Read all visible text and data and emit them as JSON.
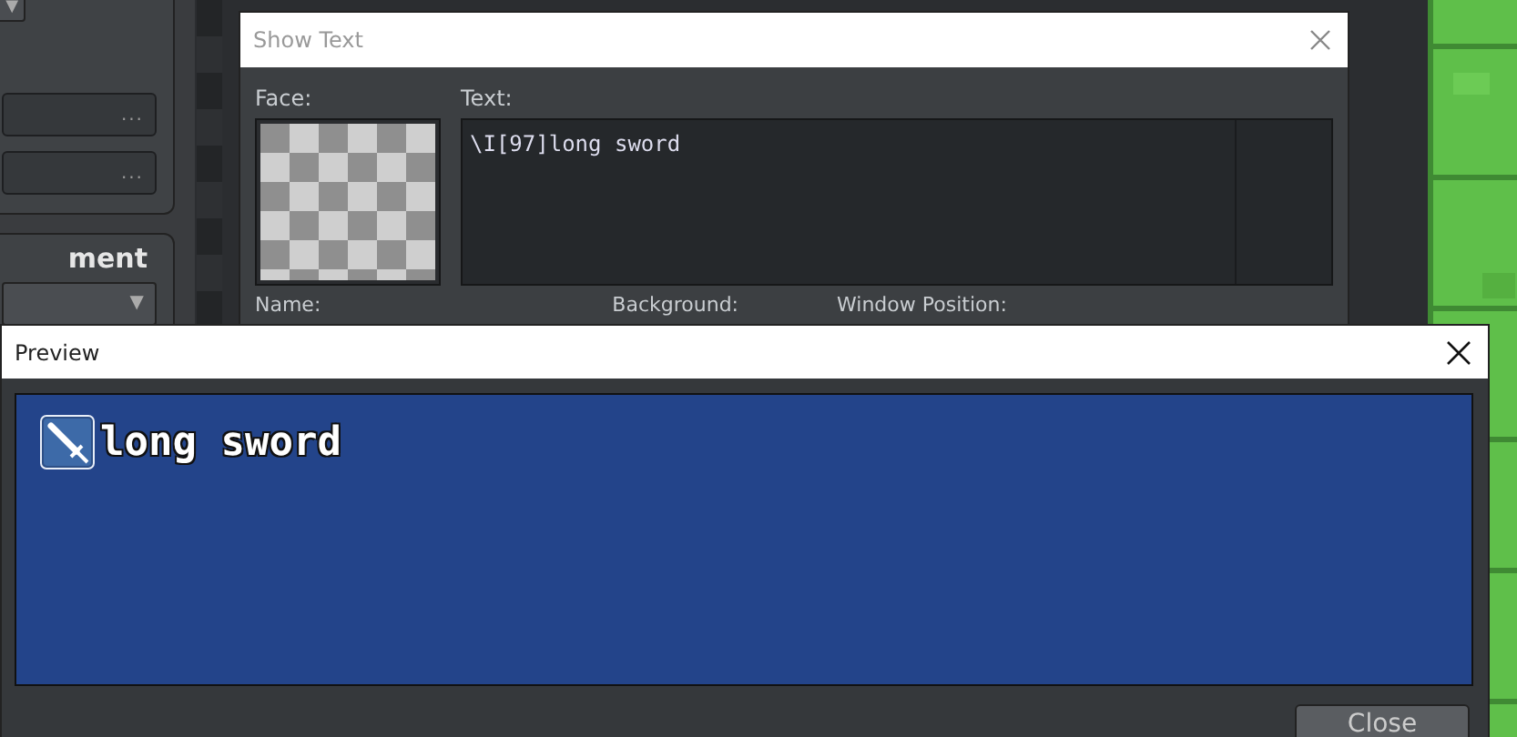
{
  "left_panel": {
    "top_dropdown": {
      "arrow": "▼"
    },
    "fields": [
      {
        "button": "..."
      },
      {
        "button": "..."
      }
    ],
    "section_title": "ment",
    "section_dropdown": {
      "arrow": "▼"
    }
  },
  "show_text_window": {
    "title": "Show Text",
    "face_label": "Face:",
    "text_label": "Text:",
    "text_value": "\\I[97]long sword",
    "labels": [
      "Name:",
      "Background:",
      "Window Position:"
    ]
  },
  "preview_window": {
    "title": "Preview",
    "message": "long sword",
    "close_button": "Close"
  }
}
